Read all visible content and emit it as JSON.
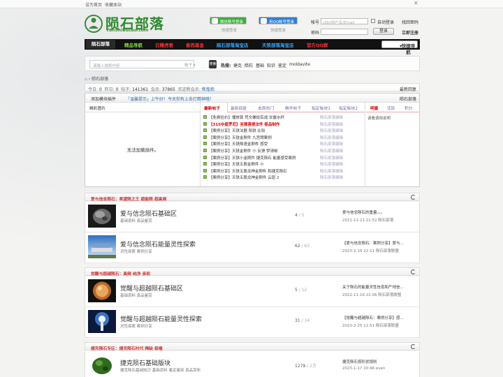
{
  "topbar": {
    "set_home": "设为首页",
    "bookmark": "收藏本站"
  },
  "logo": {
    "title": "陨石部落",
    "url": "YunShiBuLuo.com"
  },
  "login": {
    "wechat_btn": "微信账号登录",
    "wechat_sub": "快捷登录",
    "qq_btn": "用QQ帐号登录",
    "qq_sub": "快捷登录",
    "account_label": "帐号",
    "account_placeholder": "UID/用户名/Email",
    "auto_login": "自动登录",
    "find_pwd": "找回密码",
    "password_label": "密码",
    "login_btn": "登录",
    "register": "立即注册",
    "colors": {
      "wechat": "#3cae3c",
      "qq": "#2f7fd6"
    }
  },
  "nav": {
    "items": [
      {
        "label": "陨石部落",
        "color": "#ffffff"
      },
      {
        "label": "精品导航",
        "color": "#7fdc3a"
      },
      {
        "label": "日赚虎君",
        "color": "#ff3030"
      },
      {
        "label": "善而基金",
        "color": "#ff3030"
      },
      {
        "label": "陨石部落淘宝店",
        "color": "#2fa8ff"
      },
      {
        "label": "天铁部落淘宝店",
        "color": "#2fa8ff"
      },
      {
        "label": "官方QQ群",
        "color": "#ff3030"
      }
    ],
    "quick": "快捷导航"
  },
  "search": {
    "placeholder": "请输入搜索内容",
    "type": "帖子",
    "go": "搜索",
    "hot_label": "热搜:",
    "hot": [
      "捷克",
      "陨石",
      "基础",
      "知识",
      "鉴定",
      "moldavite"
    ]
  },
  "breadcrumb": {
    "home": "首页",
    "current": "陨石部落"
  },
  "stats": {
    "today_label": "今日:",
    "today": "0",
    "yesterday_label": "昨日:",
    "yesterday": "0",
    "posts_label": "帖子:",
    "posts": "141361",
    "members_label": "会员:",
    "members": "37865",
    "welcome_label": "欢迎新会员:",
    "welcome": "焦煌炮",
    "latest": "最新回复"
  },
  "panel": {
    "add_plugin": "添加模块插件",
    "notice": "「温馨提示」上午好！今天你有上去打精神哦！",
    "right_title": "陨石部落",
    "left_tab": "精彩图片",
    "empty": "无法加载插件。",
    "mid_tabs": [
      "最新帖子",
      "最新回复",
      "本周热门",
      "精华帖子",
      "指定板块1",
      "指定板块2"
    ],
    "right_tabs": [
      "明星",
      "活跃",
      "积分"
    ],
    "right_note": "请看调用说明",
    "rows": [
      {
        "title": "【免费估价】播放锁 梵文螺纹后战 甘露水杯",
        "author": "陨石部落编辑",
        "red": false
      },
      {
        "title": "【315中庭罗尼】至尊菩提法件 极品制作",
        "author": "陨石部落编辑",
        "red": true
      },
      {
        "title": "【案例分享】天铁法器 阳铁 比较",
        "author": "陨石部落编辑",
        "red": false
      },
      {
        "title": "【案例分享】天铁金刚件 九宫牌案例",
        "author": "陨石部落编辑",
        "red": false
      },
      {
        "title": "【案例分享】天铁降速金刚杵 感受",
        "author": "陨石部落编辑",
        "red": false
      },
      {
        "title": "【案例分享】天铁金刚件 小 反馈 梦清晰",
        "author": "陨石部落编辑",
        "red": false
      },
      {
        "title": "【案例分享】天铁小金刚件 捷克陨石 能量感受案例",
        "author": "陨石部落编辑",
        "red": false
      },
      {
        "title": "【案例分享】天铁五股金刚件 小",
        "author": "陨石部落编辑",
        "red": false
      },
      {
        "title": "【案例分享】天铁五股龙神金刚杵 和捷克陨石",
        "author": "陨石部落编辑",
        "red": false
      },
      {
        "title": "【案例分享】天铁五股龙神金刚件 云层 2",
        "author": "陨石部落编辑",
        "red": false
      }
    ]
  },
  "sections": [
    {
      "title": "爱与信念陨石：希望陨之王 超能陨 超高频",
      "forums": [
        {
          "name": "爱与信念陨石基础区",
          "sub": "基础资料 真品鉴赏",
          "threads": "4",
          "posts": "5",
          "last_title": "爱与信念陨石的重量。。。",
          "last_meta": "2021-11-21 21:52 陨石部落",
          "img": "stone"
        },
        {
          "name": "爱与信念陨石能量灵性探索",
          "sub": "灵性探索 案例分享",
          "threads": "62",
          "posts": "63",
          "last_title": "【爱与信念陨石：案例分享】爱与...",
          "last_meta": "2023-2-16 22:11 陨石部落联盟",
          "img": "sky"
        }
      ]
    },
    {
      "title": "觉醒与超越陨石：高频 纯净 亲和",
      "forums": [
        {
          "name": "觉醒与超越陨石基础区",
          "sub": "基础资料 真品鉴赏",
          "threads": "5",
          "posts": "12",
          "last_title": "关于陨石的能量灵性信息和产地信...",
          "last_meta": "2022-11-16 22:06 陨石部落联盟",
          "img": "amber"
        },
        {
          "name": "觉醒与超越陨石能量灵性探索",
          "sub": "灵性探索 案例分享",
          "threads": "31",
          "posts": "34",
          "last_title": "【觉醒与超越陨石：案例分享】感...",
          "last_meta": "2023-2-25 11:51 陨石部落联盟",
          "img": "tree"
        }
      ]
    },
    {
      "title": "捷克陨石专区：捷克陨石时代 稀缺 极端",
      "forums": [
        {
          "name": "捷克陨石基础版块",
          "sub": "捷克陨石基础知识 基础资料 鉴定鉴别 真品赏析",
          "threads": "1279",
          "posts": "2万",
          "last_title": "捷克陨石按形状规则",
          "last_meta": "2023-1-17 20:46 even",
          "img": "moldavite"
        }
      ]
    }
  ]
}
